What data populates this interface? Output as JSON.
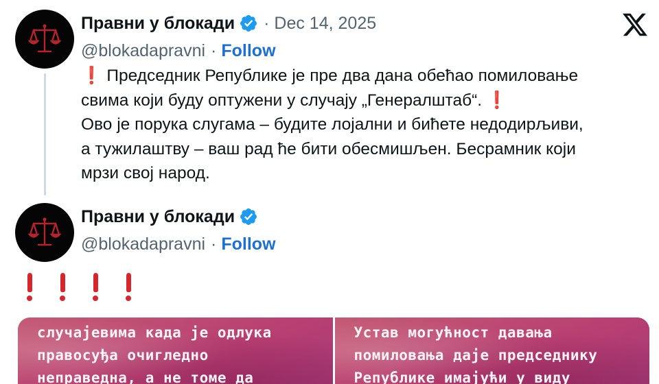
{
  "tweet1": {
    "name": "Правни у блокади",
    "separator": "·",
    "date": "Dec 14, 2025",
    "handle": "@blokadapravni",
    "handle_sep": "·",
    "follow": "Follow",
    "lines": [
      "Председник Републике је пре два дана обећао помиловање",
      "свима који буду оптужени у случају „Генералштаб“.",
      "Ово је порука слугама – будите лојални и бићете недодирљиви,",
      "а тужилаштву – ваш рад ће бити обесмишљен. Бесрамник који",
      "мрзи свој народ."
    ]
  },
  "tweet2": {
    "name": "Правни у блокади",
    "handle": "@blokadapravni",
    "handle_sep": "·",
    "follow": "Follow"
  },
  "icons": {
    "verified": "verified-badge-icon",
    "x_logo": "x-logo-icon",
    "exclamation": "red-exclamation-icon",
    "avatar": "scales-of-justice-icon"
  },
  "colors": {
    "accent": "#1d6fd6",
    "verified": "#1d9bf0",
    "muted": "#536471",
    "exclamation": "#d9262c"
  },
  "media": {
    "left_lines": [
      "случајевима када је одлука",
      "правосуђа очигледно",
      "неправедна, а не томе да"
    ],
    "right_lines": [
      "Устав могућност давања",
      "помиловања даје председнику",
      "Републике имајући у виду"
    ]
  }
}
